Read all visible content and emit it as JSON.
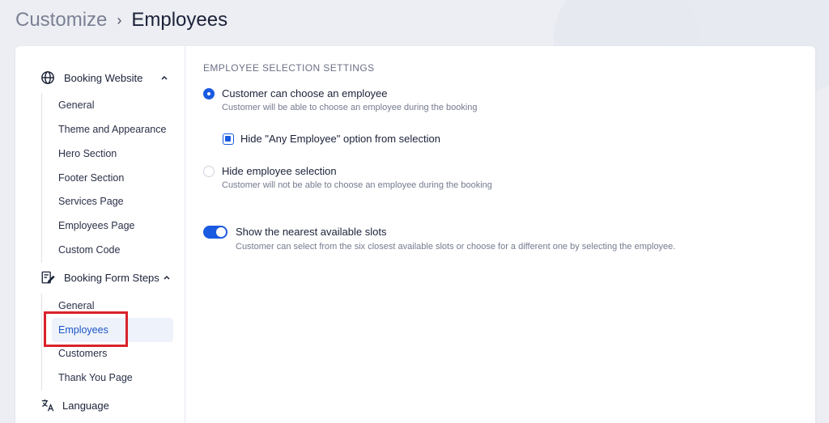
{
  "breadcrumb": {
    "parent": "Customize",
    "separator": "›",
    "current": "Employees"
  },
  "sidebar": {
    "booking_website": {
      "label": "Booking Website",
      "icon": "globe-icon",
      "items": [
        "General",
        "Theme and Appearance",
        "Hero Section",
        "Footer Section",
        "Services Page",
        "Employees Page",
        "Custom Code"
      ]
    },
    "booking_form_steps": {
      "label": "Booking Form Steps",
      "icon": "form-edit-icon",
      "items": [
        "General",
        "Employees",
        "Customers",
        "Thank You Page"
      ],
      "active": "Employees"
    },
    "language": {
      "label": "Language",
      "icon": "translate-icon"
    }
  },
  "settings": {
    "section_title": "EMPLOYEE SELECTION SETTINGS",
    "choose_employee": {
      "label": "Customer can choose an employee",
      "description": "Customer will be able to choose an employee during the booking",
      "selected": true
    },
    "hide_any_employee": {
      "label": "Hide \"Any Employee\" option from selection",
      "checked": true
    },
    "hide_selection": {
      "label": "Hide employee selection",
      "description": "Customer will not be able to choose an employee during the booking",
      "selected": false
    },
    "nearest_slots": {
      "label": "Show the nearest available slots",
      "description": "Customer can select from the six closest available slots or choose for a different one by selecting the employee.",
      "enabled": true
    }
  },
  "colors": {
    "accent": "#1a5ae0",
    "highlight": "#d9222a"
  }
}
